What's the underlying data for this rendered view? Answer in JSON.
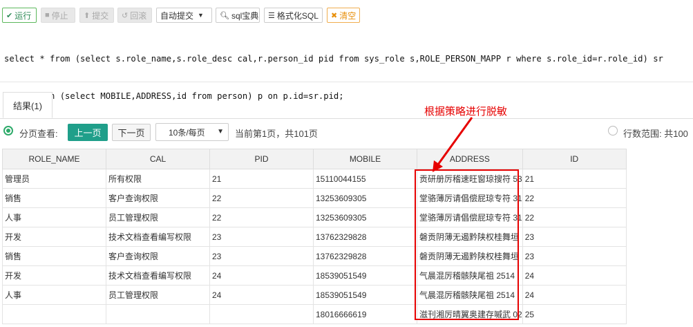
{
  "toolbar": {
    "run": {
      "icon": "check-icon",
      "label": "运行",
      "color": "#2e8b57"
    },
    "stop": {
      "icon": "stop-icon",
      "label": "停止"
    },
    "commit": {
      "icon": "arrow-up-icon",
      "label": "提交"
    },
    "rollback": {
      "icon": "undo-icon",
      "label": "回滚"
    },
    "autocommit": {
      "label": "自动提交"
    },
    "sqlbook": {
      "icon": "search-icon",
      "label": "sql宝典"
    },
    "format": {
      "icon": "list-icon",
      "label": "格式化SQL"
    },
    "clear": {
      "icon": "close-icon",
      "label": "清空",
      "color": "#e8900c"
    }
  },
  "editor": {
    "line1": "select * from (select s.role_name,s.role_desc cal,r.person_id pid from sys_role s,ROLE_PERSON_MAPP r where s.role_id=r.role_id) sr",
    "line2": "right join (select MOBILE,ADDRESS,id from person) p on p.id=sr.pid;"
  },
  "results_tab": {
    "label": "结果(1)"
  },
  "annotation": {
    "text": "根据策略进行脱敏",
    "color": "#e60000"
  },
  "pager": {
    "mode_label": "分页查看:",
    "prev_label": "上一页",
    "next_label": "下一页",
    "page_size": "10条/每页",
    "status": "当前第1页，共101页",
    "range_label": "行数范围: 共100"
  },
  "table": {
    "columns": [
      "ROLE_NAME",
      "CAL",
      "PID",
      "MOBILE",
      "ADDRESS",
      "ID"
    ],
    "rows": [
      [
        "管理员",
        "所有权限",
        "21",
        "15110044155",
        "贡研册厉稽速旺窗琼搜符 53",
        "21"
      ],
      [
        "销售",
        "客户查询权限",
        "22",
        "13253609305",
        "堂骆薄厉请倡偿屁琼专符 31",
        "22"
      ],
      [
        "人事",
        "员工管理权限",
        "22",
        "13253609305",
        "堂骆薄厉请倡偿屁琼专符 31",
        "22"
      ],
      [
        "开发",
        "技术文档查看编写权限",
        "23",
        "13762329828",
        "磐贡阴薄无遏黔陕权桂舞垣",
        "23"
      ],
      [
        "销售",
        "客户查询权限",
        "23",
        "13762329828",
        "磐贡阴薄无遏黔陕权桂舞垣",
        "23"
      ],
      [
        "开发",
        "技术文档查看编写权限",
        "24",
        "18539051549",
        "气晨混厉稽骸陕尾祖 2514",
        "24"
      ],
      [
        "人事",
        "员工管理权限",
        "24",
        "18539051549",
        "气晨混厉稽骸陕尾祖 2514",
        "24"
      ],
      [
        "",
        "",
        "",
        "18016666619",
        "滋刊湘厉晴翼奥建存嘁武 02",
        "25"
      ]
    ]
  }
}
